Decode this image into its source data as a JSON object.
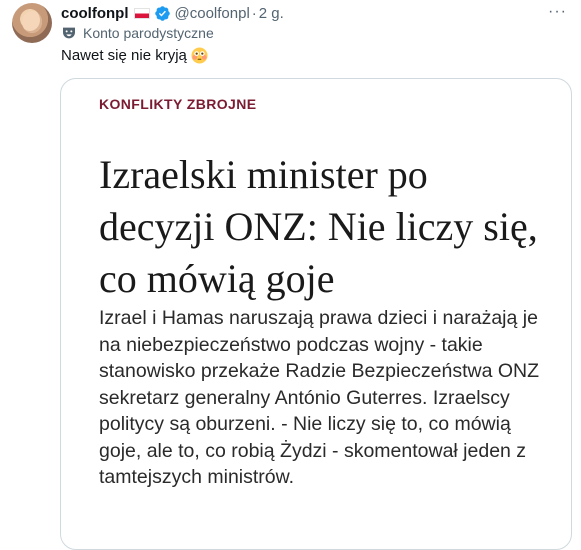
{
  "tweet": {
    "display_name": "coolfonpl",
    "handle": "@coolfonpl",
    "separator": "·",
    "time": "2 g.",
    "account_label": "Konto parodystyczne",
    "text": "Nawet się nie kryją",
    "emoji": "flushed-face-emoji",
    "more": "···"
  },
  "card": {
    "section": "KONFLIKTY ZBROJNE",
    "headline": "Izraelski minister po decyzji ONZ: Nie liczy się, co mówią goje",
    "lead": "Izrael i Hamas naruszają prawa dzieci i narażają je na niebezpieczeństwo podczas wojny - takie stanowisko przekaże Radzie Bezpieczeństwa ONZ sekretarz generalny António Guterres. Izraelscy politycy są oburzeni. - Nie liczy się to, co mówią goje, ale to, co robią Żydzi - skomentował jeden z tamtejszych ministrów."
  },
  "colors": {
    "verified": "#1d9bf0",
    "section": "#7b1b32",
    "secondary_text": "#536471"
  }
}
